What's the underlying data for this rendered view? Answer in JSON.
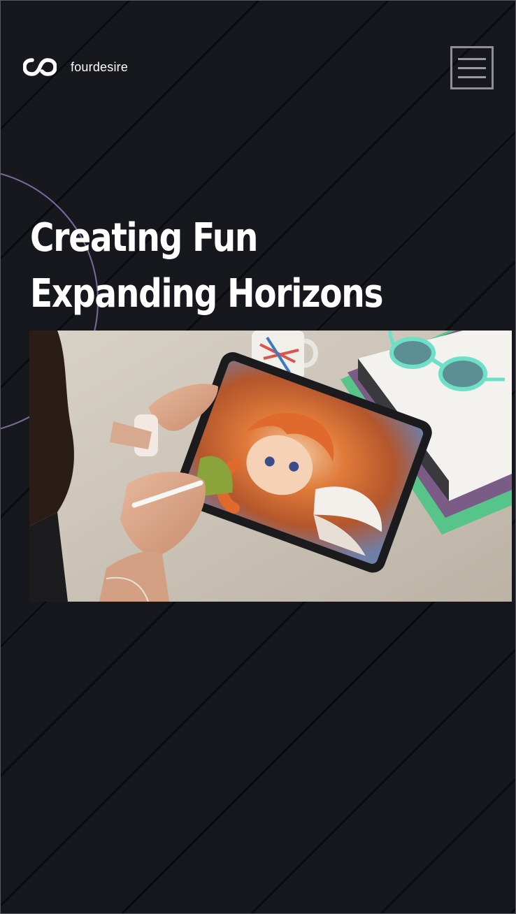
{
  "brand": {
    "name": "fourdesire",
    "logo_icon": "infinity-icon"
  },
  "menu": {
    "icon": "hamburger-menu-icon"
  },
  "hero": {
    "line1": "Creating Fun",
    "line2": "Expanding Horizons"
  },
  "image": {
    "alt": "Artist drawing a winged character with orange hair on a tablet beside books, sunglasses and a mug"
  },
  "colors": {
    "background": "#17181e",
    "text": "#ffffff",
    "accent_circle": "#7a6a9c",
    "menu_border": "#8e8e94"
  }
}
